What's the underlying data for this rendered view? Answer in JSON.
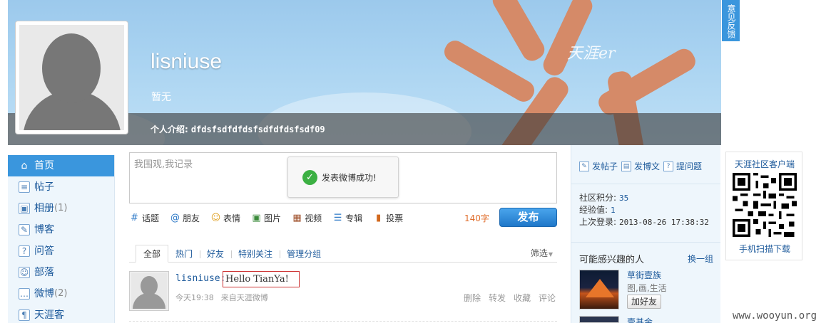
{
  "banner": {
    "username": "lisniuse",
    "subtitle": "暂无",
    "intro_label": "个人介绍:",
    "intro_value": "dfdsfsdfdfdsfsdfdfdsfsdf09",
    "brand_watermark": "天涯er"
  },
  "feedback_tab": "意见反馈",
  "sidebar": {
    "items": [
      {
        "label": "首页",
        "icon": "home-icon",
        "count": ""
      },
      {
        "label": "帖子",
        "icon": "post-icon",
        "count": ""
      },
      {
        "label": "相册",
        "icon": "album-icon",
        "count": "(1)"
      },
      {
        "label": "博客",
        "icon": "blog-icon",
        "count": ""
      },
      {
        "label": "问答",
        "icon": "question-icon",
        "count": ""
      },
      {
        "label": "部落",
        "icon": "tribe-icon",
        "count": ""
      },
      {
        "label": "微博",
        "icon": "weibo-icon",
        "count": "(2)"
      },
      {
        "label": "天涯客",
        "icon": "footprint-icon",
        "count": ""
      }
    ]
  },
  "composer": {
    "placeholder": "我围观,我记录",
    "toast": "发表微博成功!",
    "char_count": "140字",
    "publish_label": "发布",
    "tools": [
      {
        "label": "话题",
        "icon": "hash-icon"
      },
      {
        "label": "朋友",
        "icon": "at-icon"
      },
      {
        "label": "表情",
        "icon": "smiley-icon"
      },
      {
        "label": "图片",
        "icon": "image-icon"
      },
      {
        "label": "视频",
        "icon": "video-icon"
      },
      {
        "label": "专辑",
        "icon": "album-list-icon"
      },
      {
        "label": "投票",
        "icon": "vote-icon"
      }
    ]
  },
  "feed_tabs": {
    "tabs": [
      "全部",
      "热门",
      "好友",
      "特别关注",
      "管理分组"
    ],
    "filter_label": "筛选"
  },
  "feed": {
    "user": "lisniuse:",
    "content": "Hello TianYa!",
    "time": "今天19:38",
    "source": "来自天涯微博",
    "actions": [
      "删除",
      "转发",
      "收藏",
      "评论"
    ]
  },
  "right": {
    "quick_links": [
      {
        "label": "发帖子",
        "icon": "edit-icon"
      },
      {
        "label": "发博文",
        "icon": "blog-edit-icon"
      },
      {
        "label": "提问题",
        "icon": "question-icon"
      }
    ],
    "stats": {
      "points_label": "社区积分:",
      "points_value": "35",
      "exp_label": "经验值:",
      "exp_value": "1",
      "last_login_label": "上次登录:",
      "last_login_value": "2013-08-26 17:38:32"
    },
    "interest_title": "可能感兴趣的人",
    "swap_label": "换一组",
    "people": [
      {
        "name": "草街壹族",
        "tags": "图,画,生活",
        "add_label": "加好友"
      },
      {
        "name": "壹基金"
      }
    ]
  },
  "app_promo": {
    "title": "天涯社区客户端",
    "scan_label": "手机扫描下载"
  },
  "site_watermark": "www.wooyun.org",
  "colors": {
    "accent": "#3a96dd",
    "link": "#1d5a9b",
    "count_orange": "#e06d2b",
    "highlight_border": "#cc3333"
  }
}
